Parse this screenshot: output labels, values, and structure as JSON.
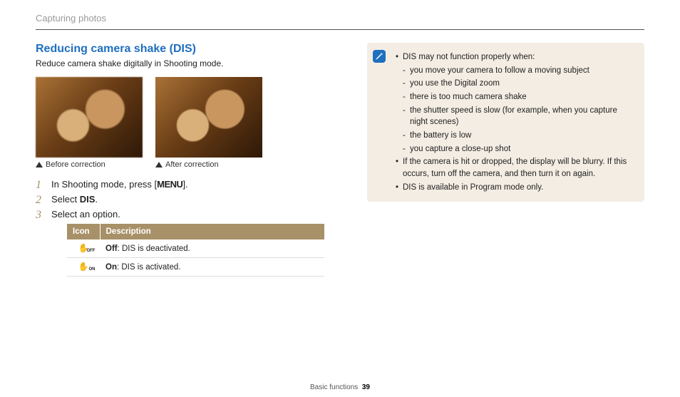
{
  "breadcrumb": "Capturing photos",
  "title": "Reducing camera shake (DIS)",
  "intro": "Reduce camera shake digitally in Shooting mode.",
  "captions": {
    "before": "Before correction",
    "after": "After correction"
  },
  "steps": {
    "s1_pre": "In Shooting mode, press [",
    "s1_menu": "MENU",
    "s1_post": "].",
    "s2_pre": "Select ",
    "s2_bold": "DIS",
    "s2_post": ".",
    "s3": "Select an option."
  },
  "table": {
    "h_icon": "Icon",
    "h_desc": "Description",
    "rows": [
      {
        "mode": "OFF",
        "bold": "Off",
        "rest": ": DIS is deactivated."
      },
      {
        "mode": "ON",
        "bold": "On",
        "rest": ": DIS is activated."
      }
    ]
  },
  "notes": {
    "b1": "DIS may not function properly when:",
    "b1_items": [
      "you move your camera to follow a moving subject",
      "you use the Digital zoom",
      "there is too much camera shake",
      "the shutter speed is slow (for example, when you capture night scenes)",
      "the battery is low",
      "you capture a close-up shot"
    ],
    "b2": "If the camera is hit or dropped, the display will be blurry. If this occurs, turn off the camera, and then turn it on again.",
    "b3": "DIS is available in Program mode only."
  },
  "footer": {
    "section": "Basic functions",
    "page": "39"
  }
}
